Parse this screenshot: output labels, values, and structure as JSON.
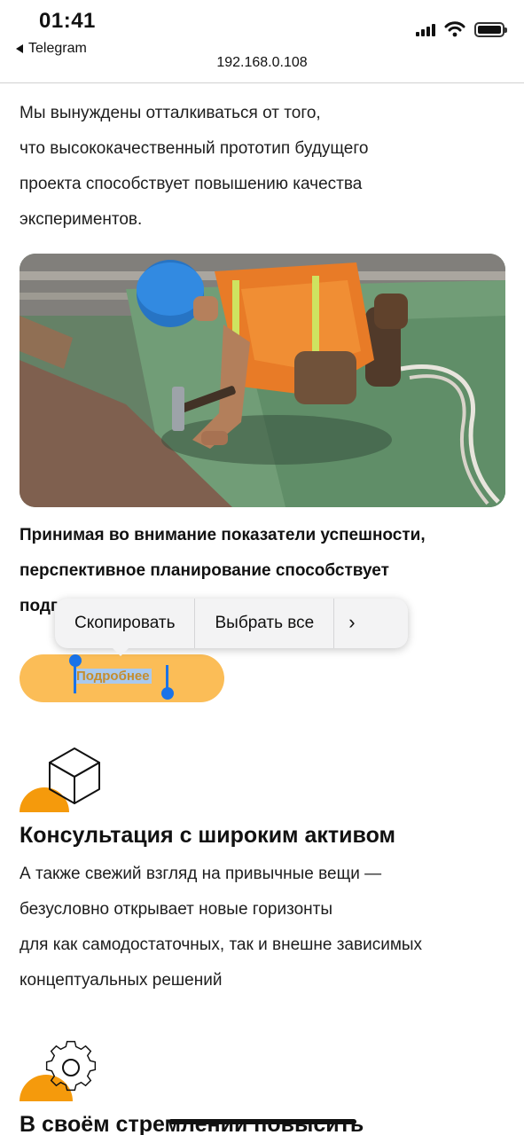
{
  "status_bar": {
    "time": "01:41",
    "back_app": "Telegram",
    "url": "192.168.0.108"
  },
  "intro": {
    "lines": [
      "Мы вынуждены отталкиваться от того,",
      "что высококачественный прототип будущего",
      "проекта способствует повышению качества",
      "экспериментов."
    ]
  },
  "highlight": {
    "lines": [
      "Принимая во внимание показатели успешности,",
      "перспективное планирование способствует",
      "подготовке и реализации новых принципов"
    ]
  },
  "more_button": {
    "label": "Подробнее"
  },
  "context_menu": {
    "copy": "Скопировать",
    "select_all": "Выбрать все",
    "more": "›"
  },
  "feature_1": {
    "title": "Консультация с широким активом",
    "lines": [
      "А также свежий взгляд на привычные вещи —",
      "безусловно открывает новые горизонты",
      "для как самодостаточных, так и внешне зависимых",
      "концептуальных решений"
    ]
  },
  "feature_2": {
    "title": "В своём стремлении повысить"
  },
  "colors": {
    "accent": "#fbbd57",
    "accent_dark": "#f59a0c",
    "selection": "#1a73e8"
  }
}
